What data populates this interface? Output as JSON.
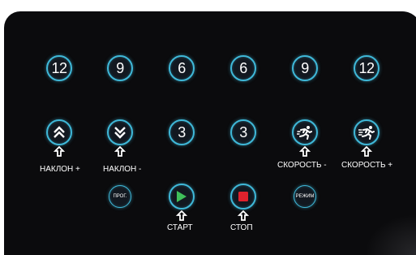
{
  "panel": {
    "row_top": [
      "12",
      "9",
      "6",
      "6",
      "9",
      "12"
    ],
    "row_mid": [
      "3",
      "3"
    ],
    "program_label": "ПРОГ.",
    "mode_label": "РЕЖИМ"
  },
  "captions": {
    "incline_up": "НАКЛОН +",
    "incline_down": "НАКЛОН -",
    "speed_down": "СКОРОСТЬ -",
    "speed_up": "СКОРОСТЬ +",
    "start": "СТАРТ",
    "stop": "СТОП"
  },
  "colors": {
    "ring": "#3fb8d8",
    "start": "#3fbf5a",
    "stop": "#e0222d",
    "panel": "#0b0b0d"
  }
}
